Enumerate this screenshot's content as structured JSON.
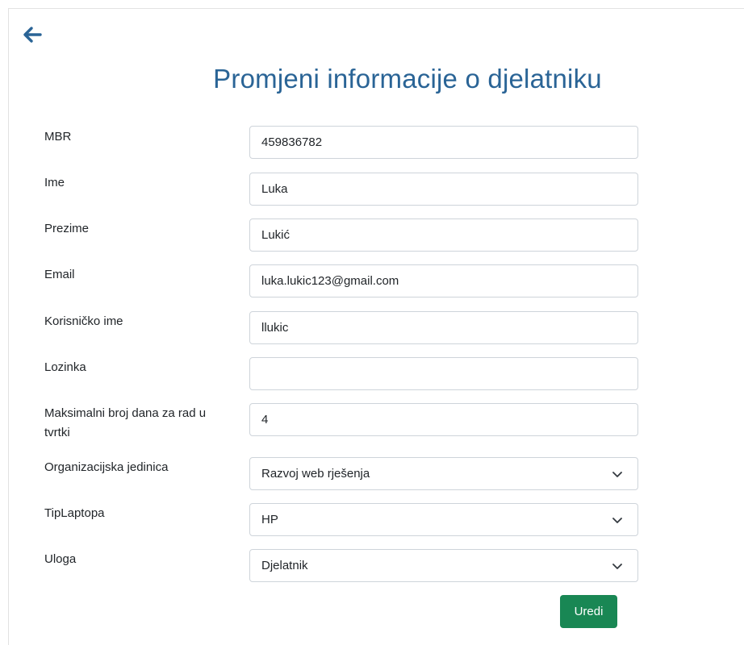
{
  "header": {
    "title": "Promjeni informacije o djelatniku",
    "back_icon": "arrow-left-icon"
  },
  "form": {
    "fields": [
      {
        "label": "MBR",
        "value": "459836782"
      },
      {
        "label": "Ime",
        "value": "Luka"
      },
      {
        "label": "Prezime",
        "value": "Lukić"
      },
      {
        "label": "Email",
        "value": "luka.lukic123@gmail.com"
      },
      {
        "label": "Korisničko ime",
        "value": "llukic"
      },
      {
        "label": "Lozinka",
        "value": ""
      },
      {
        "label": "Maksimalni broj dana za rad u tvrtki",
        "value": "4"
      }
    ],
    "selects": [
      {
        "label": "Organizacijska jedinica",
        "value": "Razvoj web rješenja"
      },
      {
        "label": "TipLaptopa",
        "value": "HP"
      },
      {
        "label": "Uloga",
        "value": "Djelatnik"
      }
    ],
    "submit_label": "Uredi"
  },
  "colors": {
    "accent": "#2a6496",
    "submit": "#198754"
  }
}
